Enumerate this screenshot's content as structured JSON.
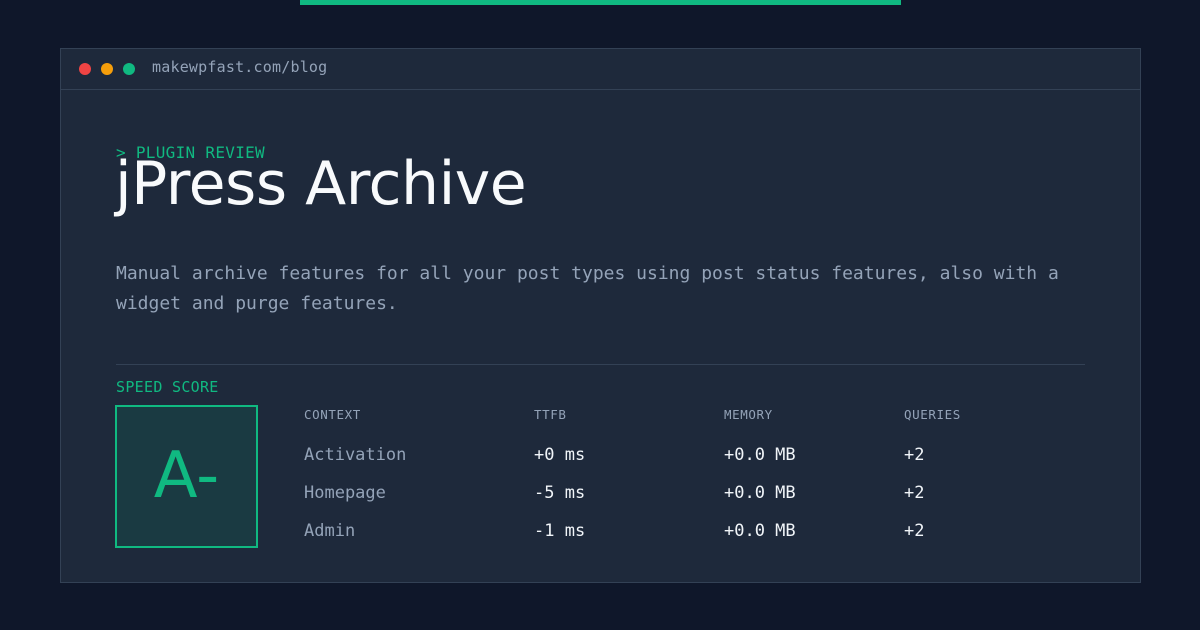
{
  "window": {
    "url": "makewpfast.com/blog"
  },
  "header": {
    "eyebrow": "> PLUGIN REVIEW",
    "title": "jPress Archive",
    "description": "Manual archive features for all your post types using post status features, also with a widget and purge features."
  },
  "speed": {
    "label": "SPEED SCORE",
    "grade": "A-"
  },
  "table": {
    "columns": [
      "CONTEXT",
      "TTFB",
      "MEMORY",
      "QUERIES"
    ],
    "rows": [
      {
        "context": "Activation",
        "ttfb": "+0 ms",
        "memory": "+0.0 MB",
        "queries": "+2"
      },
      {
        "context": "Homepage",
        "ttfb": "-5 ms",
        "memory": "+0.0 MB",
        "queries": "+2"
      },
      {
        "context": "Admin",
        "ttfb": "-1 ms",
        "memory": "+0.0 MB",
        "queries": "+2"
      }
    ]
  },
  "colors": {
    "background": "#0f172a",
    "card": "#1e293b",
    "accent": "#10b981",
    "muted_text": "#94a3b8",
    "strong_text": "#f8fafc",
    "dot_red": "#ef4444",
    "dot_yellow": "#f59e0b",
    "dot_green": "#10b981"
  }
}
